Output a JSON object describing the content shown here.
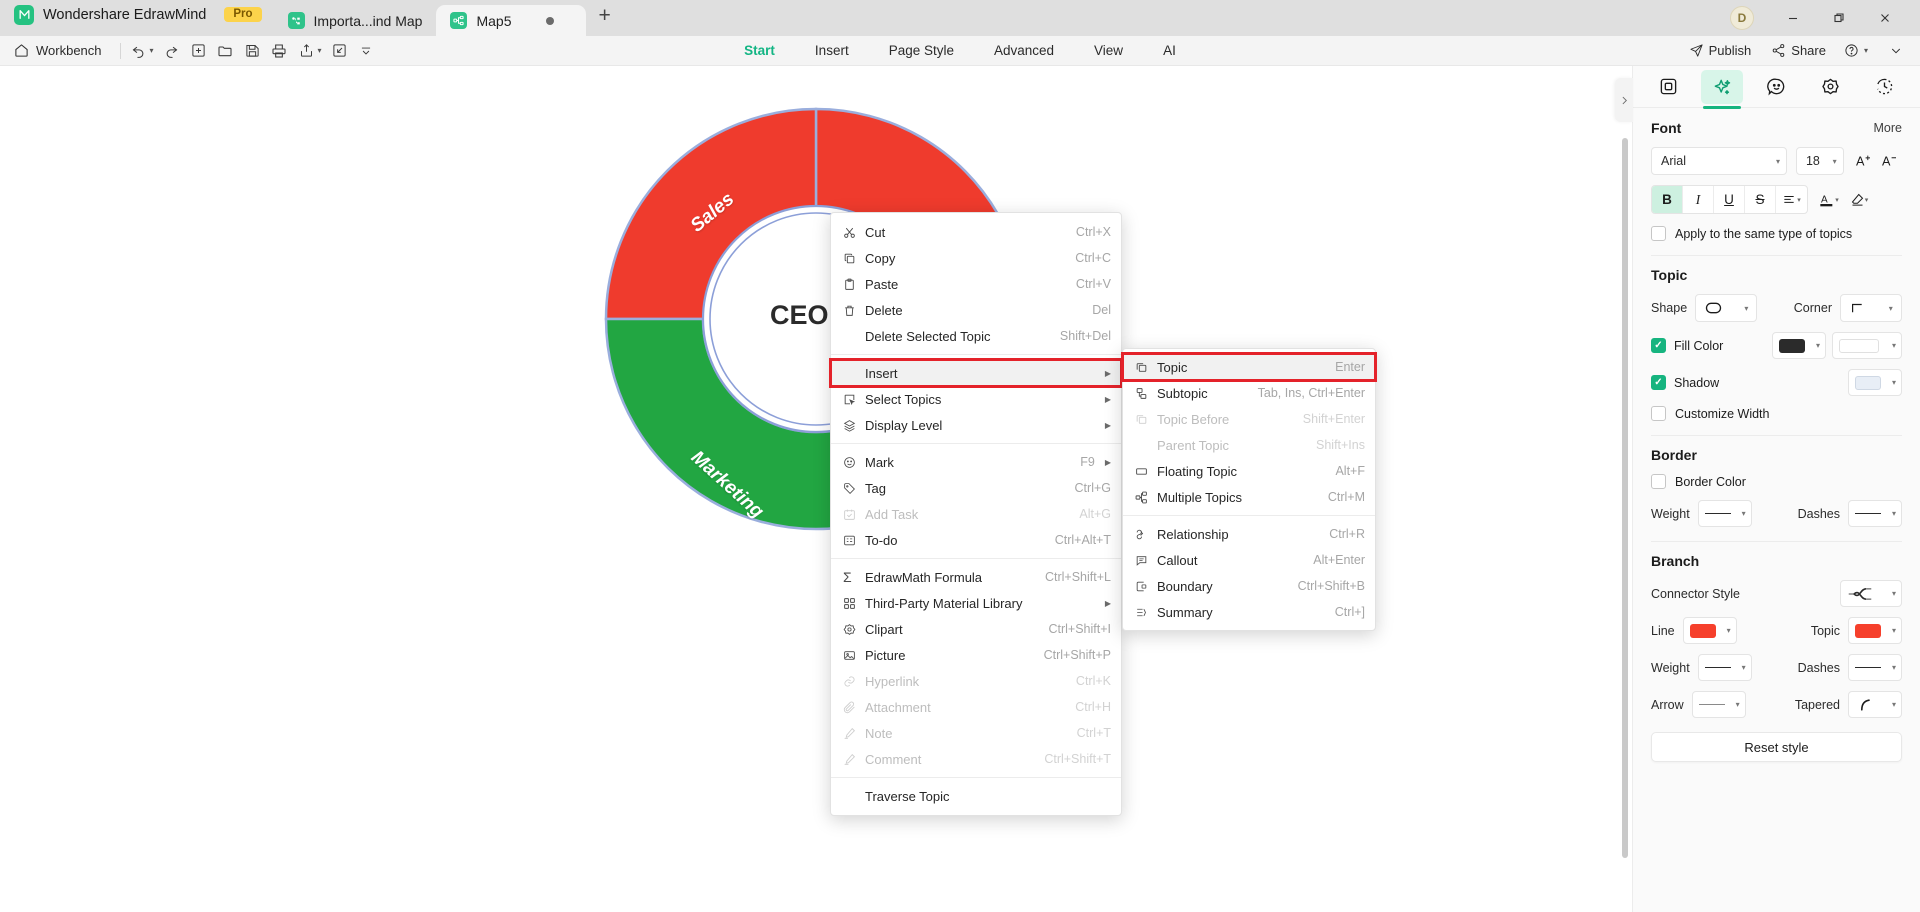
{
  "titlebar": {
    "brand": "Wondershare EdrawMind",
    "pro_badge": "Pro",
    "tabs": [
      {
        "label": "Importa...ind Map",
        "active": false
      },
      {
        "label": "Map5",
        "active": true
      }
    ],
    "add_tab": "+",
    "avatar_initial": "D",
    "window_buttons": {
      "minimize": "—",
      "maximize": "❐",
      "close": "✕"
    }
  },
  "menubar": {
    "workbench": "Workbench",
    "quick_actions": [
      "undo-icon",
      "redo-icon",
      "new-icon",
      "open-icon",
      "save-icon",
      "print-icon",
      "export-icon",
      "collapse-icon",
      "more-icon"
    ],
    "ribbon_tabs": [
      {
        "label": "Start",
        "active": true
      },
      {
        "label": "Insert",
        "active": false
      },
      {
        "label": "Page Style",
        "active": false
      },
      {
        "label": "Advanced",
        "active": false
      },
      {
        "label": "View",
        "active": false
      },
      {
        "label": "AI",
        "active": false
      }
    ],
    "publish": "Publish",
    "share": "Share",
    "help": "?"
  },
  "canvas": {
    "center_topic": "CEO",
    "ring_segments": [
      {
        "label": "Sales",
        "color": "#ef3b2d"
      },
      {
        "label": "Marketing",
        "color": "#22a642"
      },
      {
        "label": "",
        "color": "#f5b324"
      }
    ]
  },
  "context_menu": {
    "items": [
      {
        "icon": "cut-icon",
        "label": "Cut",
        "key": "Ctrl+X",
        "disabled": false,
        "arrow": false
      },
      {
        "icon": "copy-icon",
        "label": "Copy",
        "key": "Ctrl+C",
        "disabled": false,
        "arrow": false
      },
      {
        "icon": "paste-icon",
        "label": "Paste",
        "key": "Ctrl+V",
        "disabled": false,
        "arrow": false
      },
      {
        "icon": "delete-icon",
        "label": "Delete",
        "key": "Del",
        "disabled": false,
        "arrow": false
      },
      {
        "icon": "none",
        "label": "Delete Selected Topic",
        "key": "Shift+Del",
        "disabled": false,
        "arrow": false
      },
      {
        "sep": true
      },
      {
        "icon": "none",
        "label": "Insert",
        "key": "",
        "disabled": false,
        "arrow": true,
        "highlight": true
      },
      {
        "icon": "select-topics-icon",
        "label": "Select Topics",
        "key": "",
        "disabled": false,
        "arrow": true
      },
      {
        "icon": "display-level-icon",
        "label": "Display Level",
        "key": "",
        "disabled": false,
        "arrow": true
      },
      {
        "sep": true
      },
      {
        "icon": "mark-icon",
        "label": "Mark",
        "key": "F9",
        "disabled": false,
        "arrow": true
      },
      {
        "icon": "tag-icon",
        "label": "Tag",
        "key": "Ctrl+G",
        "disabled": false,
        "arrow": false
      },
      {
        "icon": "add-task-icon",
        "label": "Add Task",
        "key": "Alt+G",
        "disabled": true,
        "arrow": false
      },
      {
        "icon": "todo-icon",
        "label": "To-do",
        "key": "Ctrl+Alt+T",
        "disabled": false,
        "arrow": false
      },
      {
        "sep": true
      },
      {
        "icon": "formula-icon",
        "label": "EdrawMath Formula",
        "key": "Ctrl+Shift+L",
        "disabled": false,
        "arrow": false
      },
      {
        "icon": "library-icon",
        "label": "Third-Party Material Library",
        "key": "",
        "disabled": false,
        "arrow": true
      },
      {
        "icon": "clipart-icon",
        "label": "Clipart",
        "key": "Ctrl+Shift+I",
        "disabled": false,
        "arrow": false
      },
      {
        "icon": "picture-icon",
        "label": "Picture",
        "key": "Ctrl+Shift+P",
        "disabled": false,
        "arrow": false
      },
      {
        "icon": "hyperlink-icon",
        "label": "Hyperlink",
        "key": "Ctrl+K",
        "disabled": true,
        "arrow": false
      },
      {
        "icon": "attachment-icon",
        "label": "Attachment",
        "key": "Ctrl+H",
        "disabled": true,
        "arrow": false
      },
      {
        "icon": "note-icon",
        "label": "Note",
        "key": "Ctrl+T",
        "disabled": true,
        "arrow": false
      },
      {
        "icon": "comment-icon",
        "label": "Comment",
        "key": "Ctrl+Shift+T",
        "disabled": true,
        "arrow": false
      },
      {
        "sep": true
      },
      {
        "icon": "none",
        "label": "Traverse Topic",
        "key": "",
        "disabled": false,
        "arrow": false
      }
    ]
  },
  "submenu": {
    "items": [
      {
        "icon": "topic-icon",
        "label": "Topic",
        "key": "Enter",
        "disabled": false,
        "highlight": true
      },
      {
        "icon": "subtopic-icon",
        "label": "Subtopic",
        "key": "Tab, Ins, Ctrl+Enter",
        "disabled": false
      },
      {
        "icon": "topic-before-icon",
        "label": "Topic Before",
        "key": "Shift+Enter",
        "disabled": true
      },
      {
        "icon": "none",
        "label": "Parent Topic",
        "key": "Shift+Ins",
        "disabled": true
      },
      {
        "icon": "floating-topic-icon",
        "label": "Floating Topic",
        "key": "Alt+F",
        "disabled": false
      },
      {
        "icon": "multiple-topics-icon",
        "label": "Multiple Topics",
        "key": "Ctrl+M",
        "disabled": false
      },
      {
        "sep": true
      },
      {
        "icon": "relationship-icon",
        "label": "Relationship",
        "key": "Ctrl+R",
        "disabled": false
      },
      {
        "icon": "callout-icon",
        "label": "Callout",
        "key": "Alt+Enter",
        "disabled": false
      },
      {
        "icon": "boundary-icon",
        "label": "Boundary",
        "key": "Ctrl+Shift+B",
        "disabled": false
      },
      {
        "icon": "summary-icon",
        "label": "Summary",
        "key": "Ctrl+]",
        "disabled": false
      }
    ]
  },
  "right_panel": {
    "tabs": [
      {
        "icon": "layout-icon",
        "active": false
      },
      {
        "icon": "style-icon",
        "active": true
      },
      {
        "icon": "emoji-icon",
        "active": false
      },
      {
        "icon": "clipart-icon",
        "active": false
      },
      {
        "icon": "history-icon",
        "active": false
      }
    ],
    "font": {
      "title": "Font",
      "more": "More",
      "family": "Arial",
      "size": "18",
      "increase": "A⁺",
      "decrease": "A⁻",
      "bold": "B",
      "italic": "I",
      "underline": "U",
      "strikethrough": "S",
      "align": "≡",
      "text_color": "A",
      "highlight_color": "highlight-icon",
      "apply_same_type": "Apply to the same type of topics",
      "apply_same_type_checked": false
    },
    "topic": {
      "title": "Topic",
      "shape_label": "Shape",
      "corner_label": "Corner",
      "fill_color_label": "Fill Color",
      "fill_color_checked": true,
      "fill_color_value": "#2b2b2b",
      "fill_color_secondary": "#ffffff",
      "shadow_label": "Shadow",
      "shadow_checked": true,
      "shadow_color": "#e8eef6",
      "customize_width_label": "Customize Width",
      "customize_width_checked": false
    },
    "border": {
      "title": "Border",
      "border_color_label": "Border Color",
      "border_color_checked": false,
      "weight_label": "Weight",
      "dashes_label": "Dashes"
    },
    "branch": {
      "title": "Branch",
      "connector_style_label": "Connector Style",
      "line_label": "Line",
      "line_color": "#f6402c",
      "topic_label": "Topic",
      "topic_color": "#f6402c",
      "weight_label": "Weight",
      "dashes_label": "Dashes",
      "arrow_label": "Arrow",
      "tapered_label": "Tapered",
      "reset_style": "Reset style"
    }
  }
}
